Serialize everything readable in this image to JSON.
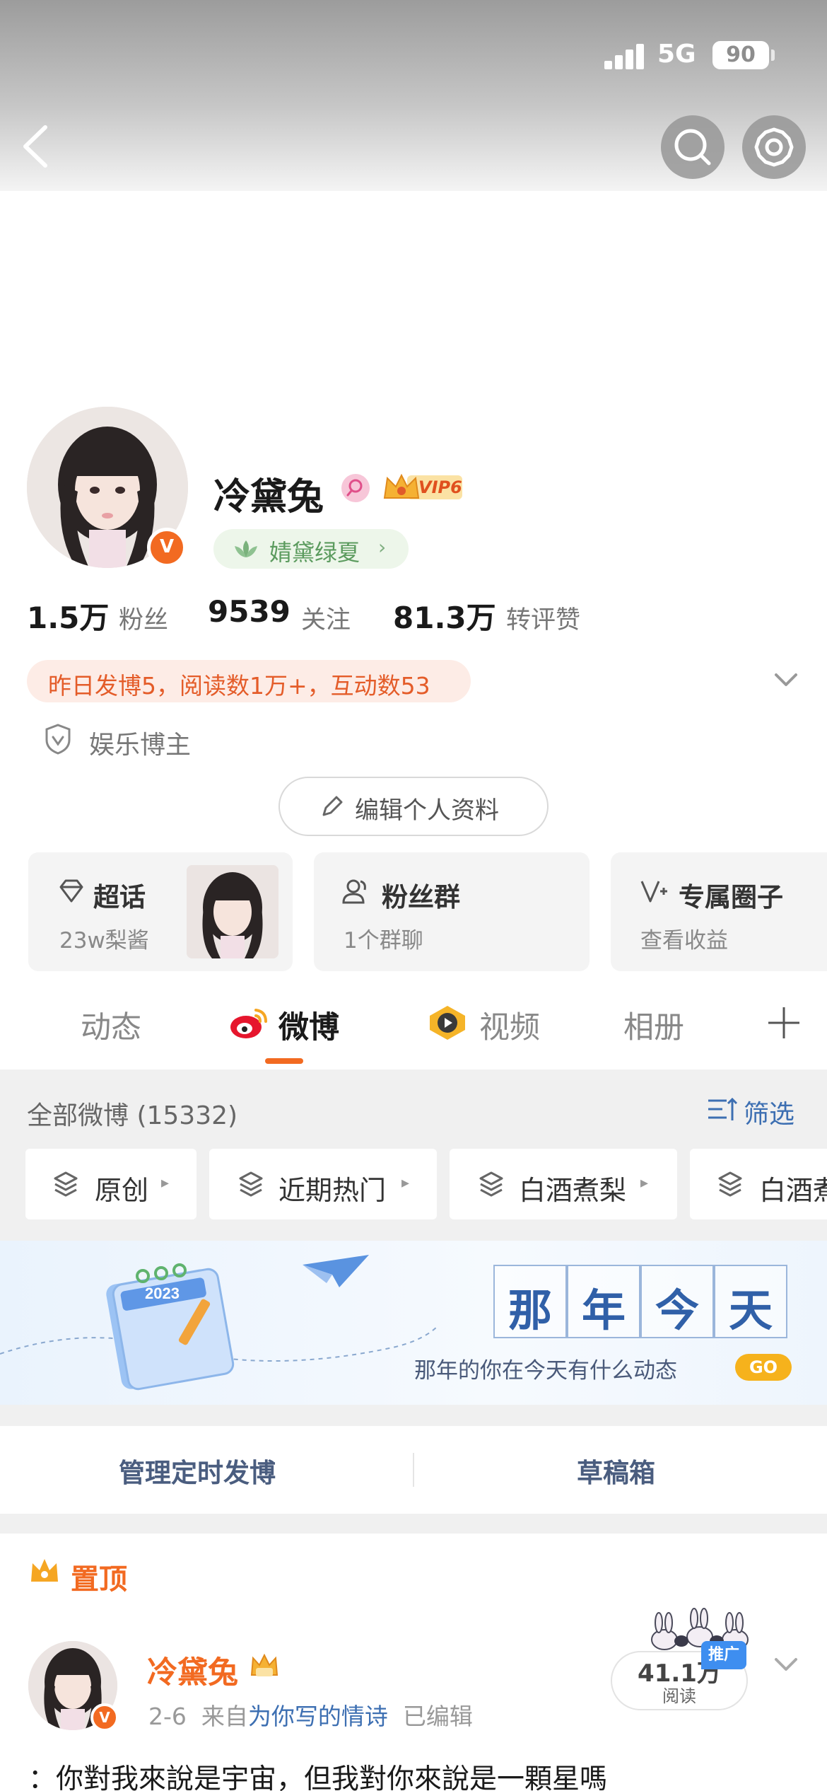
{
  "status_bar": {
    "network": "5G",
    "battery": "90"
  },
  "profile": {
    "name": "冷黛兔",
    "vip_level": "VIP6",
    "fan_tag": "婧黛绿夏",
    "verified_mark": "V",
    "stats": [
      {
        "value": "1.5万",
        "label": "粉丝"
      },
      {
        "value": "9539",
        "label": "关注"
      },
      {
        "value": "81.3万",
        "label": "转评赞"
      }
    ],
    "activity": "昨日发博5，阅读数1万+，互动数53",
    "category": "娱乐博主",
    "edit_button": "编辑个人资料"
  },
  "cards": [
    {
      "title": "超话",
      "subtitle": "23w梨酱",
      "icon": "diamond-icon"
    },
    {
      "title": "粉丝群",
      "subtitle": "1个群聊",
      "icon": "group-icon"
    },
    {
      "title": "专属圈子",
      "subtitle": "查看收益",
      "icon": "v-plus-icon"
    }
  ],
  "tabs": [
    {
      "label": "动态",
      "active": false
    },
    {
      "label": "微博",
      "active": true
    },
    {
      "label": "视频",
      "active": false
    },
    {
      "label": "相册",
      "active": false
    }
  ],
  "posts_header": {
    "all": "全部微博 (15332)",
    "filter": "筛选"
  },
  "chips": [
    "原创",
    "近期热门",
    "白酒煮梨",
    "白酒煮"
  ],
  "banner": {
    "title_chars": [
      "那",
      "年",
      "今",
      "天"
    ],
    "subtitle": "那年的你在今天有什么动态",
    "go": "GO",
    "calendar_year": "2023"
  },
  "manage": {
    "scheduled": "管理定时发博",
    "drafts": "草稿箱"
  },
  "pinned": {
    "label": "置顶",
    "author": "冷黛兔",
    "date": "2-6",
    "source_prefix": "来自",
    "source": "为你写的情诗",
    "edited": "已编辑",
    "reads": "41.1万",
    "reads_label": "阅读",
    "promo": "推广",
    "text": "：你對我來說是宇宙，但我對你來說是一顆星嗎"
  },
  "colors": {
    "accent": "#f26a21",
    "link": "#3d6fb2",
    "tag_green": "#5b9b5e"
  }
}
